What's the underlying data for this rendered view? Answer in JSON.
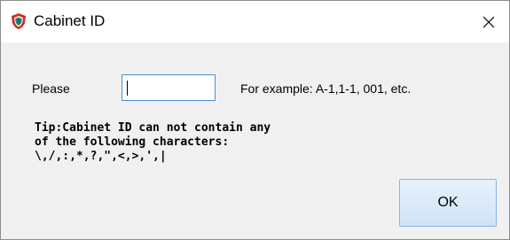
{
  "window": {
    "title": "Cabinet ID",
    "icon": "app-shield-icon",
    "close_icon": "close-icon"
  },
  "form": {
    "prompt_label": "Please",
    "input_value": "",
    "example_text": "For example: A-1,1-1, 001, etc."
  },
  "tip": {
    "line1": "Tip:Cabinet ID can not contain any",
    "line2": "of the following characters:",
    "line3": "\\,/,:,*,?,\",<,>,',|"
  },
  "buttons": {
    "ok_label": "OK"
  },
  "colors": {
    "input_border": "#4a8fd6",
    "ok_button_border": "#86b3e3",
    "ok_button_fill": "#cfe3f7",
    "dialog_background": "#f0f0f0"
  }
}
